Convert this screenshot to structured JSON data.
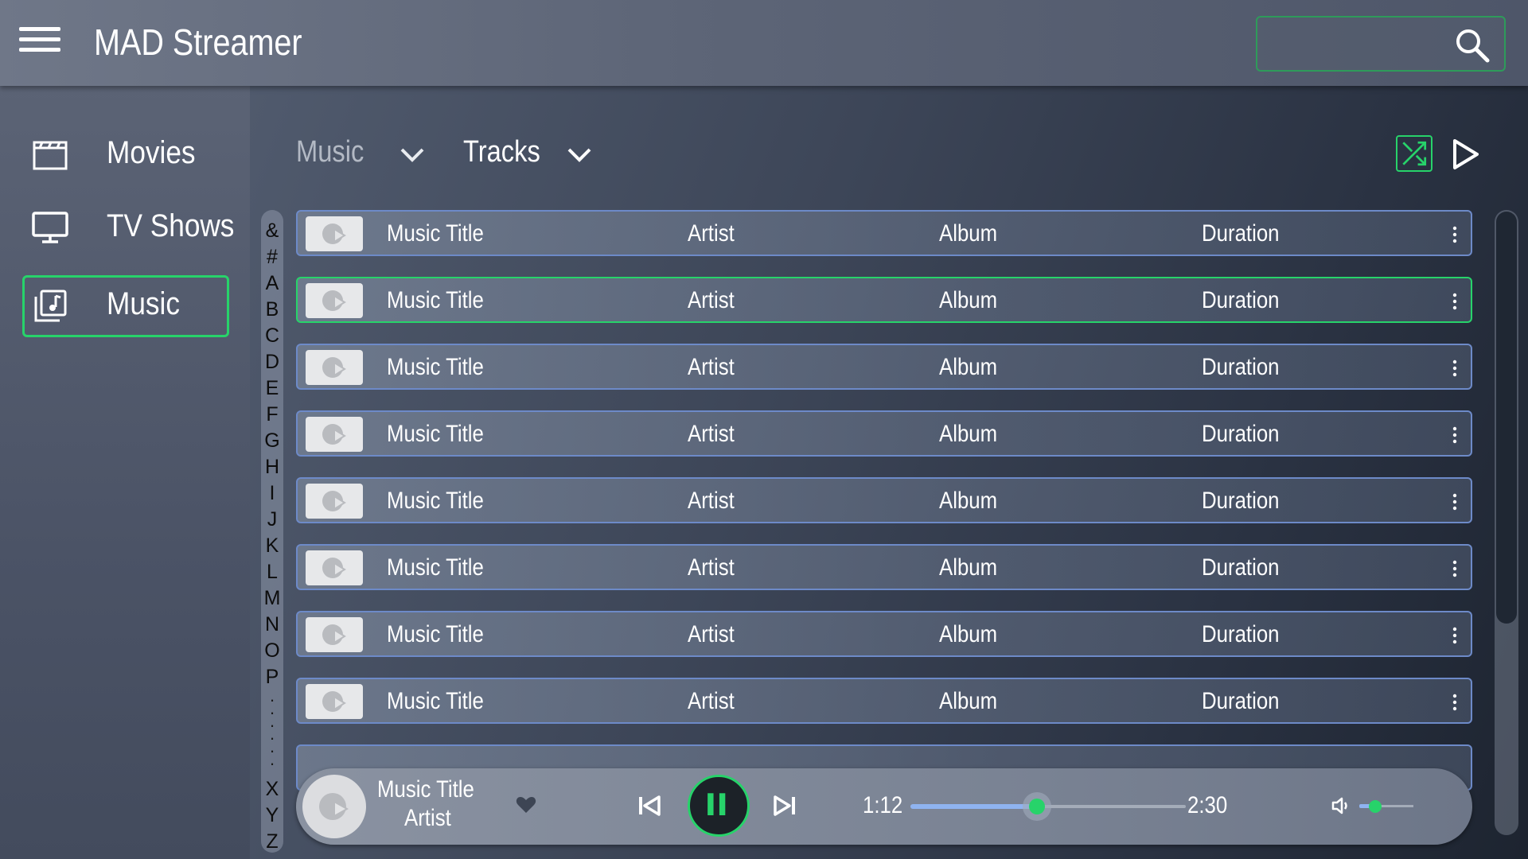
{
  "app": {
    "title": "MAD Streamer"
  },
  "search": {
    "value": "",
    "placeholder": ""
  },
  "sidebar": {
    "items": [
      {
        "label": "Movies",
        "icon": "clapperboard-icon",
        "active": false
      },
      {
        "label": "TV Shows",
        "icon": "monitor-icon",
        "active": false
      },
      {
        "label": "Music",
        "icon": "music-library-icon",
        "active": true
      }
    ]
  },
  "filters": {
    "category": "Music",
    "view": "Tracks"
  },
  "alphabet_index": {
    "top": [
      "&",
      "#",
      "A",
      "B",
      "C",
      "D",
      "E",
      "F",
      "G",
      "H",
      "I",
      "J",
      "K",
      "L",
      "M",
      "N",
      "O",
      "P"
    ],
    "bottom": [
      "X",
      "Y",
      "Z"
    ]
  },
  "tracks": [
    {
      "title": "Music Title",
      "artist": "Artist",
      "album": "Album",
      "duration": "Duration"
    },
    {
      "title": "Music Title",
      "artist": "Artist",
      "album": "Album",
      "duration": "Duration"
    },
    {
      "title": "Music Title",
      "artist": "Artist",
      "album": "Album",
      "duration": "Duration"
    },
    {
      "title": "Music Title",
      "artist": "Artist",
      "album": "Album",
      "duration": "Duration"
    },
    {
      "title": "Music Title",
      "artist": "Artist",
      "album": "Album",
      "duration": "Duration"
    },
    {
      "title": "Music Title",
      "artist": "Artist",
      "album": "Album",
      "duration": "Duration"
    },
    {
      "title": "Music Title",
      "artist": "Artist",
      "album": "Album",
      "duration": "Duration"
    },
    {
      "title": "Music Title",
      "artist": "Artist",
      "album": "Album",
      "duration": "Duration"
    }
  ],
  "selected_track_index": 1,
  "player": {
    "title": "Music Title",
    "artist": "Artist",
    "current_time": "1:12",
    "total_time": "2:30",
    "progress": 0.46,
    "volume": 0.3,
    "state": "playing"
  },
  "colors": {
    "accent": "#27d36a",
    "row_border": "#6d8ac8",
    "progress_fill": "#8fb3f0"
  }
}
